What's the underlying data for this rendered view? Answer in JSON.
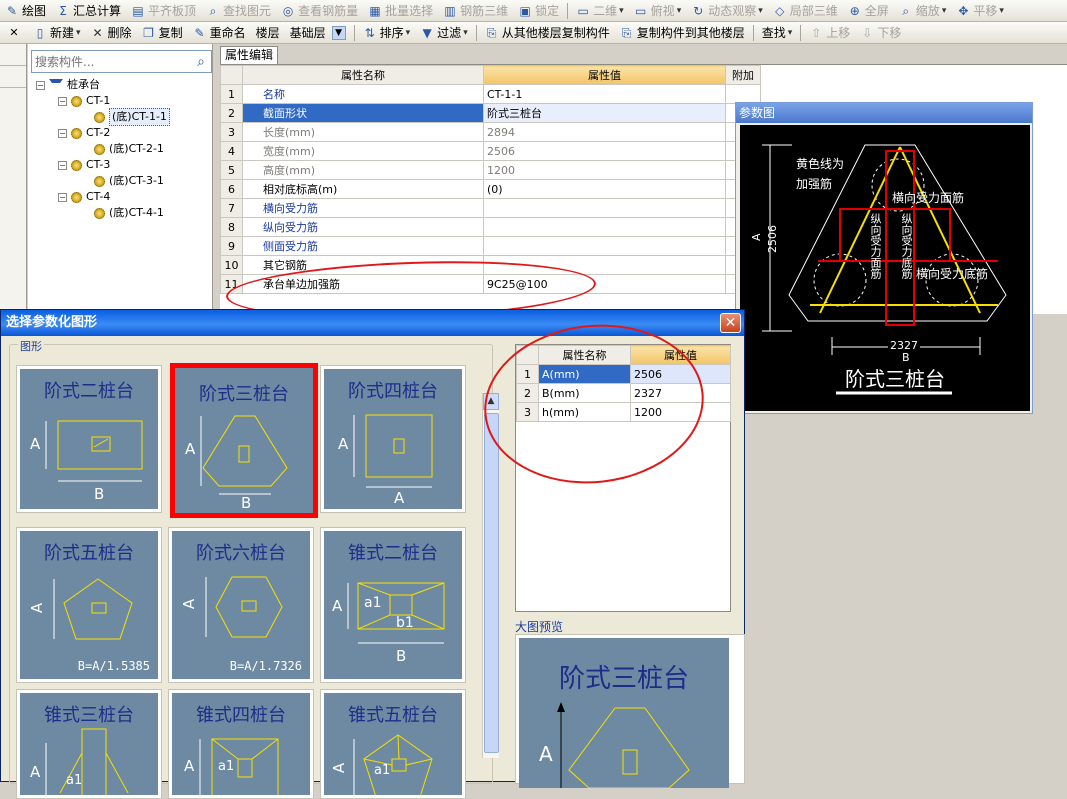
{
  "toolbar1": {
    "items": [
      {
        "label": "绘图",
        "icon": "pencil-icon",
        "enabled": true
      },
      {
        "label": "汇总计算",
        "icon": "sigma-icon",
        "enabled": true
      },
      {
        "label": "平齐板顶",
        "icon": "level-icon",
        "enabled": false
      },
      {
        "label": "查找图元",
        "icon": "find-icon",
        "enabled": false
      },
      {
        "label": "查看钢筋量",
        "icon": "view-icon",
        "enabled": false
      },
      {
        "label": "批量选择",
        "icon": "select-icon",
        "enabled": false
      },
      {
        "label": "钢筋三维",
        "icon": "rebar-3d-icon",
        "enabled": false
      },
      {
        "label": "锁定",
        "icon": "lock-icon",
        "enabled": false
      },
      {
        "label": "二维",
        "icon": "2d-icon",
        "enabled": false
      },
      {
        "label": "俯视",
        "icon": "topview-icon",
        "enabled": false
      },
      {
        "label": "动态观察",
        "icon": "orbit-icon",
        "enabled": false
      },
      {
        "label": "局部三维",
        "icon": "local-3d-icon",
        "enabled": false
      },
      {
        "label": "全屏",
        "icon": "fullscreen-icon",
        "enabled": false
      },
      {
        "label": "缩放",
        "icon": "zoom-icon",
        "enabled": false
      },
      {
        "label": "平移",
        "icon": "pan-icon",
        "enabled": false
      }
    ]
  },
  "toolbar2": {
    "new_label": "新建",
    "delete_label": "删除",
    "copy_label": "复制",
    "rename_label": "重命名",
    "floor_label": "楼层",
    "floor_value": "基础层",
    "sort_label": "排序",
    "filter_label": "过滤",
    "copy_from_label": "从其他楼层复制构件",
    "copy_to_label": "复制构件到其他楼层",
    "search_label": "查找",
    "up_label": "上移",
    "down_label": "下移"
  },
  "tree": {
    "search_placeholder": "搜索构件...",
    "root": "桩承台",
    "groups": [
      {
        "name": "CT-1",
        "child": "(底)CT-1-1"
      },
      {
        "name": "CT-2",
        "child": "(底)CT-2-1"
      },
      {
        "name": "CT-3",
        "child": "(底)CT-3-1"
      },
      {
        "name": "CT-4",
        "child": "(底)CT-4-1"
      }
    ]
  },
  "props": {
    "tab": "属性编辑",
    "col_name": "属性名称",
    "col_value": "属性值",
    "col_extra": "附加",
    "rows": [
      {
        "n": "1",
        "name": "名称",
        "value": "CT-1-1"
      },
      {
        "n": "2",
        "name": "截面形状",
        "value": "阶式三桩台"
      },
      {
        "n": "3",
        "name": "长度(mm)",
        "value": "2894"
      },
      {
        "n": "4",
        "name": "宽度(mm)",
        "value": "2506"
      },
      {
        "n": "5",
        "name": "高度(mm)",
        "value": "1200"
      },
      {
        "n": "6",
        "name": "相对底标高(m)",
        "value": "(0)"
      },
      {
        "n": "7",
        "name": "横向受力筋",
        "value": ""
      },
      {
        "n": "8",
        "name": "纵向受力筋",
        "value": ""
      },
      {
        "n": "9",
        "name": "侧面受力筋",
        "value": ""
      },
      {
        "n": "10",
        "name": "其它钢筋",
        "value": ""
      },
      {
        "n": "11",
        "name": "承台单边加强筋",
        "value": "9C25@100"
      }
    ]
  },
  "refwin": {
    "title": "参数图",
    "note1": "黄色线为",
    "note2": "加强筋",
    "label_h_face": "横向受力面筋",
    "label_v_face": "纵向受力面筋",
    "label_v_bottom": "纵向受力底筋",
    "label_h_bottom": "横向受力底筋",
    "dim_a": "2506",
    "dim_a_letter": "A",
    "dim_b": "2327",
    "dim_b_letter": "B",
    "caption": "阶式三桩台"
  },
  "dialog": {
    "title": "选择参数化图形",
    "group_label": "图形",
    "shapes": [
      {
        "name": "阶式二桩台",
        "dims": [
          "A",
          "B"
        ],
        "formula": ""
      },
      {
        "name": "阶式三桩台",
        "dims": [
          "A",
          "B"
        ],
        "formula": ""
      },
      {
        "name": "阶式四桩台",
        "dims": [
          "A",
          "A"
        ],
        "formula": ""
      },
      {
        "name": "阶式五桩台",
        "dims": [
          "A"
        ],
        "formula": "B=A/1.5385"
      },
      {
        "name": "阶式六桩台",
        "dims": [
          "A"
        ],
        "formula": "B=A/1.7326"
      },
      {
        "name": "锥式二桩台",
        "dims": [
          "A",
          "a1",
          "b1",
          "B"
        ],
        "formula": ""
      },
      {
        "name": "锥式三桩台",
        "dims": [
          "A",
          "a1"
        ],
        "formula": ""
      },
      {
        "name": "锥式四桩台",
        "dims": [
          "A",
          "a1"
        ],
        "formula": ""
      },
      {
        "name": "锥式五桩台",
        "dims": [
          "A",
          "a1"
        ],
        "formula": ""
      }
    ],
    "selected_index": 1,
    "param_grid": {
      "col_name": "属性名称",
      "col_value": "属性值",
      "rows": [
        {
          "n": "1",
          "name": "A(mm)",
          "value": "2506"
        },
        {
          "n": "2",
          "name": "B(mm)",
          "value": "2327"
        },
        {
          "n": "3",
          "name": "h(mm)",
          "value": "1200"
        }
      ]
    },
    "preview_label": "大图预览",
    "preview_title": "阶式三桩台",
    "preview_dim": "A"
  },
  "colors": {
    "annotation": "#e01818",
    "shape_bg": "#6e8aa2",
    "shape_title": "#1c2e8a",
    "rebar_yellow": "#f5e000",
    "rebar_red": "#e00000"
  }
}
